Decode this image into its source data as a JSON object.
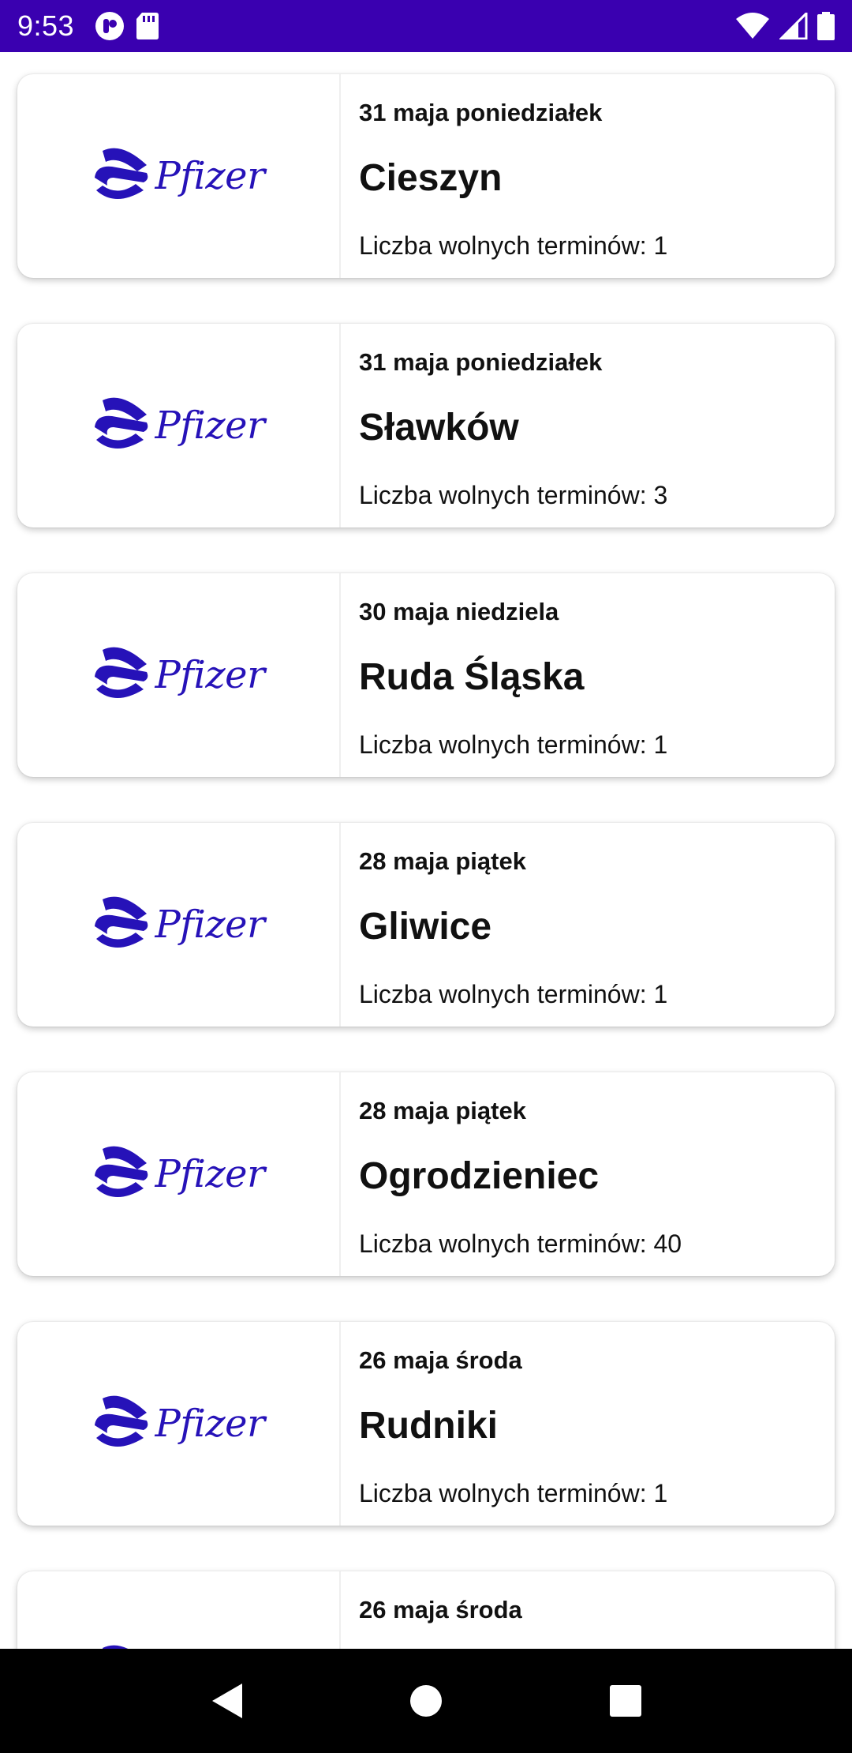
{
  "status_bar": {
    "time": "9:53",
    "icons": [
      "pocket-casts-icon",
      "sd-card-icon",
      "wifi-icon",
      "signal-icon",
      "battery-icon"
    ],
    "background": "#3A00B0"
  },
  "brand": {
    "name": "Pfizer",
    "color": "#2612B8"
  },
  "cards": [
    {
      "date": "31 maja poniedziałek",
      "city": "Cieszyn",
      "slots": "Liczba wolnych terminów: 1"
    },
    {
      "date": "31 maja poniedziałek",
      "city": "Sławków",
      "slots": "Liczba wolnych terminów: 3"
    },
    {
      "date": "30 maja niedziela",
      "city": "Ruda Śląska",
      "slots": "Liczba wolnych terminów: 1"
    },
    {
      "date": "28 maja piątek",
      "city": "Gliwice",
      "slots": "Liczba wolnych terminów: 1"
    },
    {
      "date": "28 maja piątek",
      "city": "Ogrodzieniec",
      "slots": "Liczba wolnych terminów: 40"
    },
    {
      "date": "26 maja środa",
      "city": "Rudniki",
      "slots": "Liczba wolnych terminów: 1"
    },
    {
      "date": "26 maja środa",
      "city": "",
      "slots": ""
    }
  ],
  "nav_bar": {
    "icons": [
      "back-icon",
      "home-icon",
      "recents-icon"
    ]
  }
}
